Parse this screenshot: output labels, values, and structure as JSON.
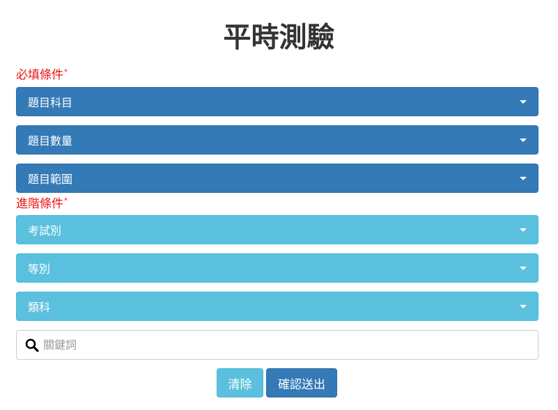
{
  "page": {
    "title": "平時測驗"
  },
  "required_section": {
    "label": "必填條件",
    "marker": "*",
    "dropdowns": [
      {
        "label": "題目科目"
      },
      {
        "label": "題目數量"
      },
      {
        "label": "題目範圍"
      }
    ]
  },
  "advanced_section": {
    "label": "進階條件",
    "marker": "*",
    "dropdowns": [
      {
        "label": "考試別"
      },
      {
        "label": "等別"
      },
      {
        "label": "類科"
      }
    ]
  },
  "search": {
    "placeholder": "關鍵詞",
    "value": "",
    "icon": "search-icon"
  },
  "actions": {
    "clear_label": "清除",
    "submit_label": "確認送出"
  },
  "colors": {
    "primary": "#337ab7",
    "info": "#5bc0de",
    "required_text": "#ee1111",
    "title_text": "#333333"
  }
}
